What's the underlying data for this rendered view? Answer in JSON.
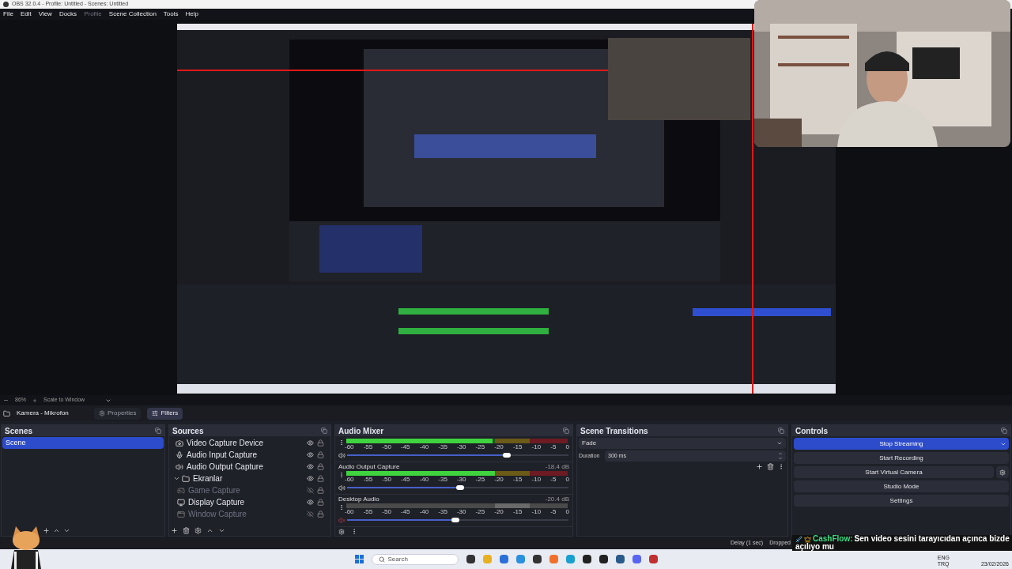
{
  "window": {
    "title": "OBS 32.0.4 - Profile: Untitled - Scenes: Untitled"
  },
  "menu": [
    {
      "label": "File",
      "disabled": false
    },
    {
      "label": "Edit",
      "disabled": false
    },
    {
      "label": "View",
      "disabled": false
    },
    {
      "label": "Docks",
      "disabled": false
    },
    {
      "label": "Profile",
      "disabled": true
    },
    {
      "label": "Scene Collection",
      "disabled": false
    },
    {
      "label": "Tools",
      "disabled": false
    },
    {
      "label": "Help",
      "disabled": false
    }
  ],
  "zoom_bar": {
    "zoom": "86%",
    "scale": "Scale to Window"
  },
  "source_toolbar": {
    "source": "Kamera - Mikrofon",
    "tabs": [
      {
        "label": "Properties",
        "selected": false
      },
      {
        "label": "Filters",
        "selected": true
      }
    ]
  },
  "scenes": {
    "title": "Scenes",
    "items": [
      {
        "label": "Scene",
        "selected": true
      }
    ]
  },
  "sources": {
    "title": "Sources",
    "items": [
      {
        "label": "Video Capture Device",
        "kind": "camera",
        "visible": true
      },
      {
        "label": "Audio Input Capture",
        "kind": "mic",
        "visible": true
      },
      {
        "label": "Audio Output Capture",
        "kind": "speaker",
        "visible": true
      },
      {
        "label": "Ekranlar",
        "kind": "group",
        "visible": true,
        "expanded": true,
        "children": [
          {
            "label": "Game Capture",
            "kind": "game",
            "visible": false
          },
          {
            "label": "Display Capture",
            "kind": "display",
            "visible": true
          },
          {
            "label": "Window Capture",
            "kind": "window",
            "visible": false
          }
        ]
      }
    ]
  },
  "audio_mixer": {
    "title": "Audio Mixer",
    "channels": [
      {
        "meter": {
          "level": 0.66
        },
        "fader": {
          "level": 0.72
        },
        "muted": false,
        "scale": [
          "-60",
          "-55",
          "-50",
          "-45",
          "-40",
          "-35",
          "-30",
          "-25",
          "-20",
          "-15",
          "-10",
          "-5",
          "0"
        ]
      },
      {
        "name": "Audio Output Capture",
        "reading": "-18.4 dB",
        "meter": {
          "level": 0.67
        },
        "fader": {
          "level": 0.51
        },
        "muted": false,
        "scale": [
          "-60",
          "-55",
          "-50",
          "-45",
          "-40",
          "-35",
          "-30",
          "-25",
          "-20",
          "-15",
          "-10",
          "-5",
          "0"
        ]
      },
      {
        "name": "Desktop Audio",
        "reading": "-20.4 dB",
        "fader": {
          "level": 0.49
        },
        "muted": true,
        "scale": [
          "-60",
          "-55",
          "-50",
          "-45",
          "-40",
          "-35",
          "-30",
          "-25",
          "-20",
          "-15",
          "-10",
          "-5",
          "0"
        ]
      }
    ]
  },
  "scene_transitions": {
    "title": "Scene Transitions",
    "transition": "Fade",
    "duration_label": "Duration",
    "duration": "300 ms"
  },
  "controls": {
    "title": "Controls",
    "buttons": [
      {
        "label": "Stop Streaming",
        "kind": "dropdown",
        "active": true
      },
      {
        "label": "Start Recording",
        "kind": "plain",
        "active": false
      },
      {
        "label": "Start Virtual Camera",
        "kind": "settings",
        "active": false
      },
      {
        "label": "Studio Mode",
        "kind": "plain",
        "active": false
      },
      {
        "label": "Settings",
        "kind": "plain",
        "active": false
      }
    ]
  },
  "status_bar": {
    "items": [
      "Delay (1 sec)",
      "Dropped"
    ]
  },
  "chat": {
    "user": "CashFlow:",
    "color": "#3ddc84",
    "lines": [
      "Sen video sesini tarayıcıdan açınca bizde",
      "açılıyo mu"
    ]
  },
  "taskbar": {
    "search": {
      "placeholder": "Search"
    },
    "language": [
      "ENG",
      "TRQ"
    ],
    "date": "23/02/2026"
  }
}
